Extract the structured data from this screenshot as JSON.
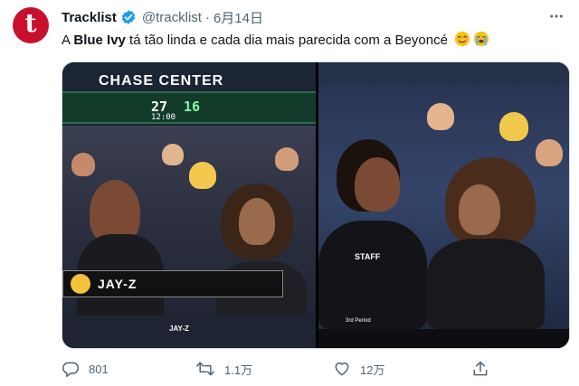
{
  "account": {
    "avatar_letter": "t",
    "display_name": "Tracklist",
    "handle": "@tracklist",
    "separator": "·",
    "date": "6月14日",
    "more_icon": "more-icon",
    "verified_icon": "verified-badge-icon"
  },
  "tweet": {
    "text_prefix": "A ",
    "text_bold": "Blue Ivy",
    "text_suffix": " tá tão linda e cada dia mais parecida com a Beyoncé",
    "emojis": [
      "smiling-face-with-heart-eyes-emoji",
      "loudly-crying-face-emoji"
    ]
  },
  "media": {
    "left_panel": {
      "arena_sign": "CHASE CENTER",
      "scoreboard_left": "27",
      "scoreboard_right": "16",
      "scoreboard_clock": "12:00",
      "nameplate": "JAY-Z",
      "ad_nameplate": "JAY-Z"
    },
    "right_panel": {
      "shirt_text": "STAFF",
      "caption": "3rd Period"
    }
  },
  "actions": {
    "reply": {
      "icon": "reply-icon",
      "count": "801"
    },
    "retweet": {
      "icon": "retweet-icon",
      "count": "1.1万"
    },
    "like": {
      "icon": "heart-icon",
      "count": "12万"
    },
    "share": {
      "icon": "share-icon"
    }
  },
  "colors": {
    "avatar_bg": "#c8102e",
    "verified": "#1d9bf0",
    "muted_text": "#536471"
  }
}
